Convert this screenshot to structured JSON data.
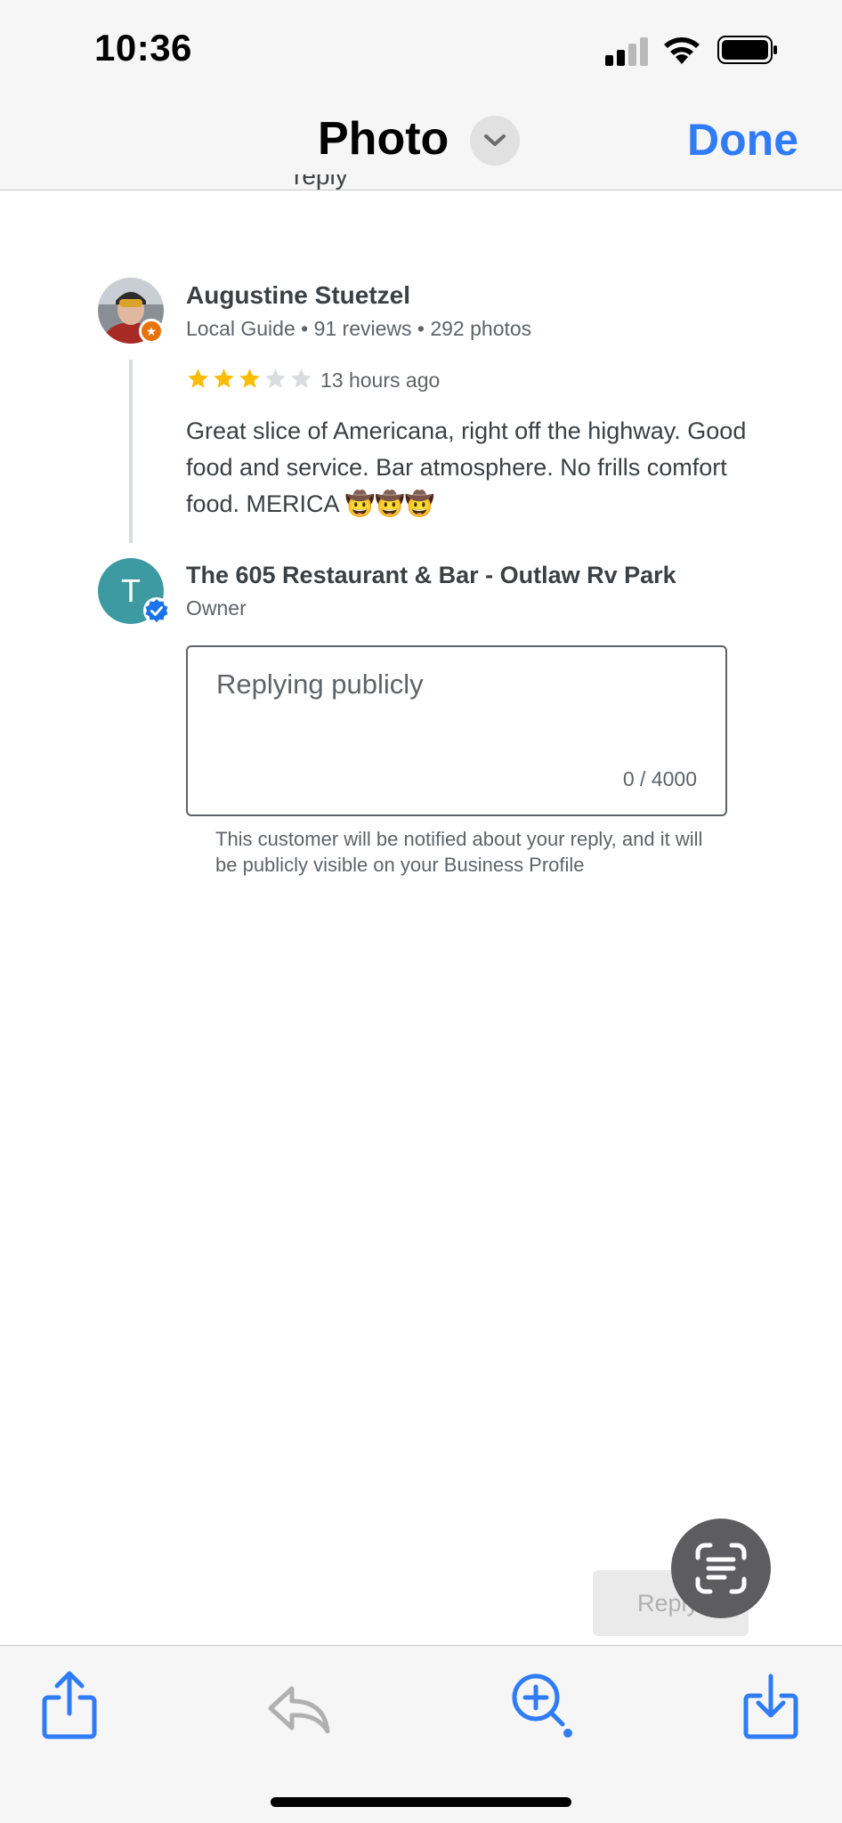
{
  "status_bar": {
    "time": "10:36"
  },
  "nav": {
    "title": "Photo",
    "done_label": "Done"
  },
  "peek_text": "reply",
  "review": {
    "reviewer_name": "Augustine Stuetzel",
    "reviewer_meta": "Local Guide • 91 reviews • 292 photos",
    "rating": 3,
    "rating_max": 5,
    "time_ago": "13 hours ago",
    "text": "Great slice of Americana, right off the highway. Good food and service. Bar atmosphere. No frills comfort food. MERICA 🤠🤠🤠"
  },
  "owner": {
    "avatar_letter": "T",
    "name": "The 605 Restaurant & Bar - Outlaw Rv Park",
    "role": "Owner"
  },
  "reply": {
    "placeholder": "Replying publicly",
    "counter": "0 / 4000",
    "note": "This customer will be notified about your reply, and it will be publicly visible on your Business Profile",
    "button_label": "Reply"
  },
  "colors": {
    "accent": "#2f7cf6",
    "star_filled": "#fbbc04",
    "star_empty": "#dadce0",
    "owner_avatar": "#3d9aa0",
    "guide_badge": "#e8710a",
    "verified": "#1a73e8"
  },
  "icons": {
    "share": "share-icon",
    "reply": "reply-arrow-icon",
    "zoom": "zoom-in-icon",
    "save": "download-icon",
    "live_text": "live-text-icon"
  }
}
